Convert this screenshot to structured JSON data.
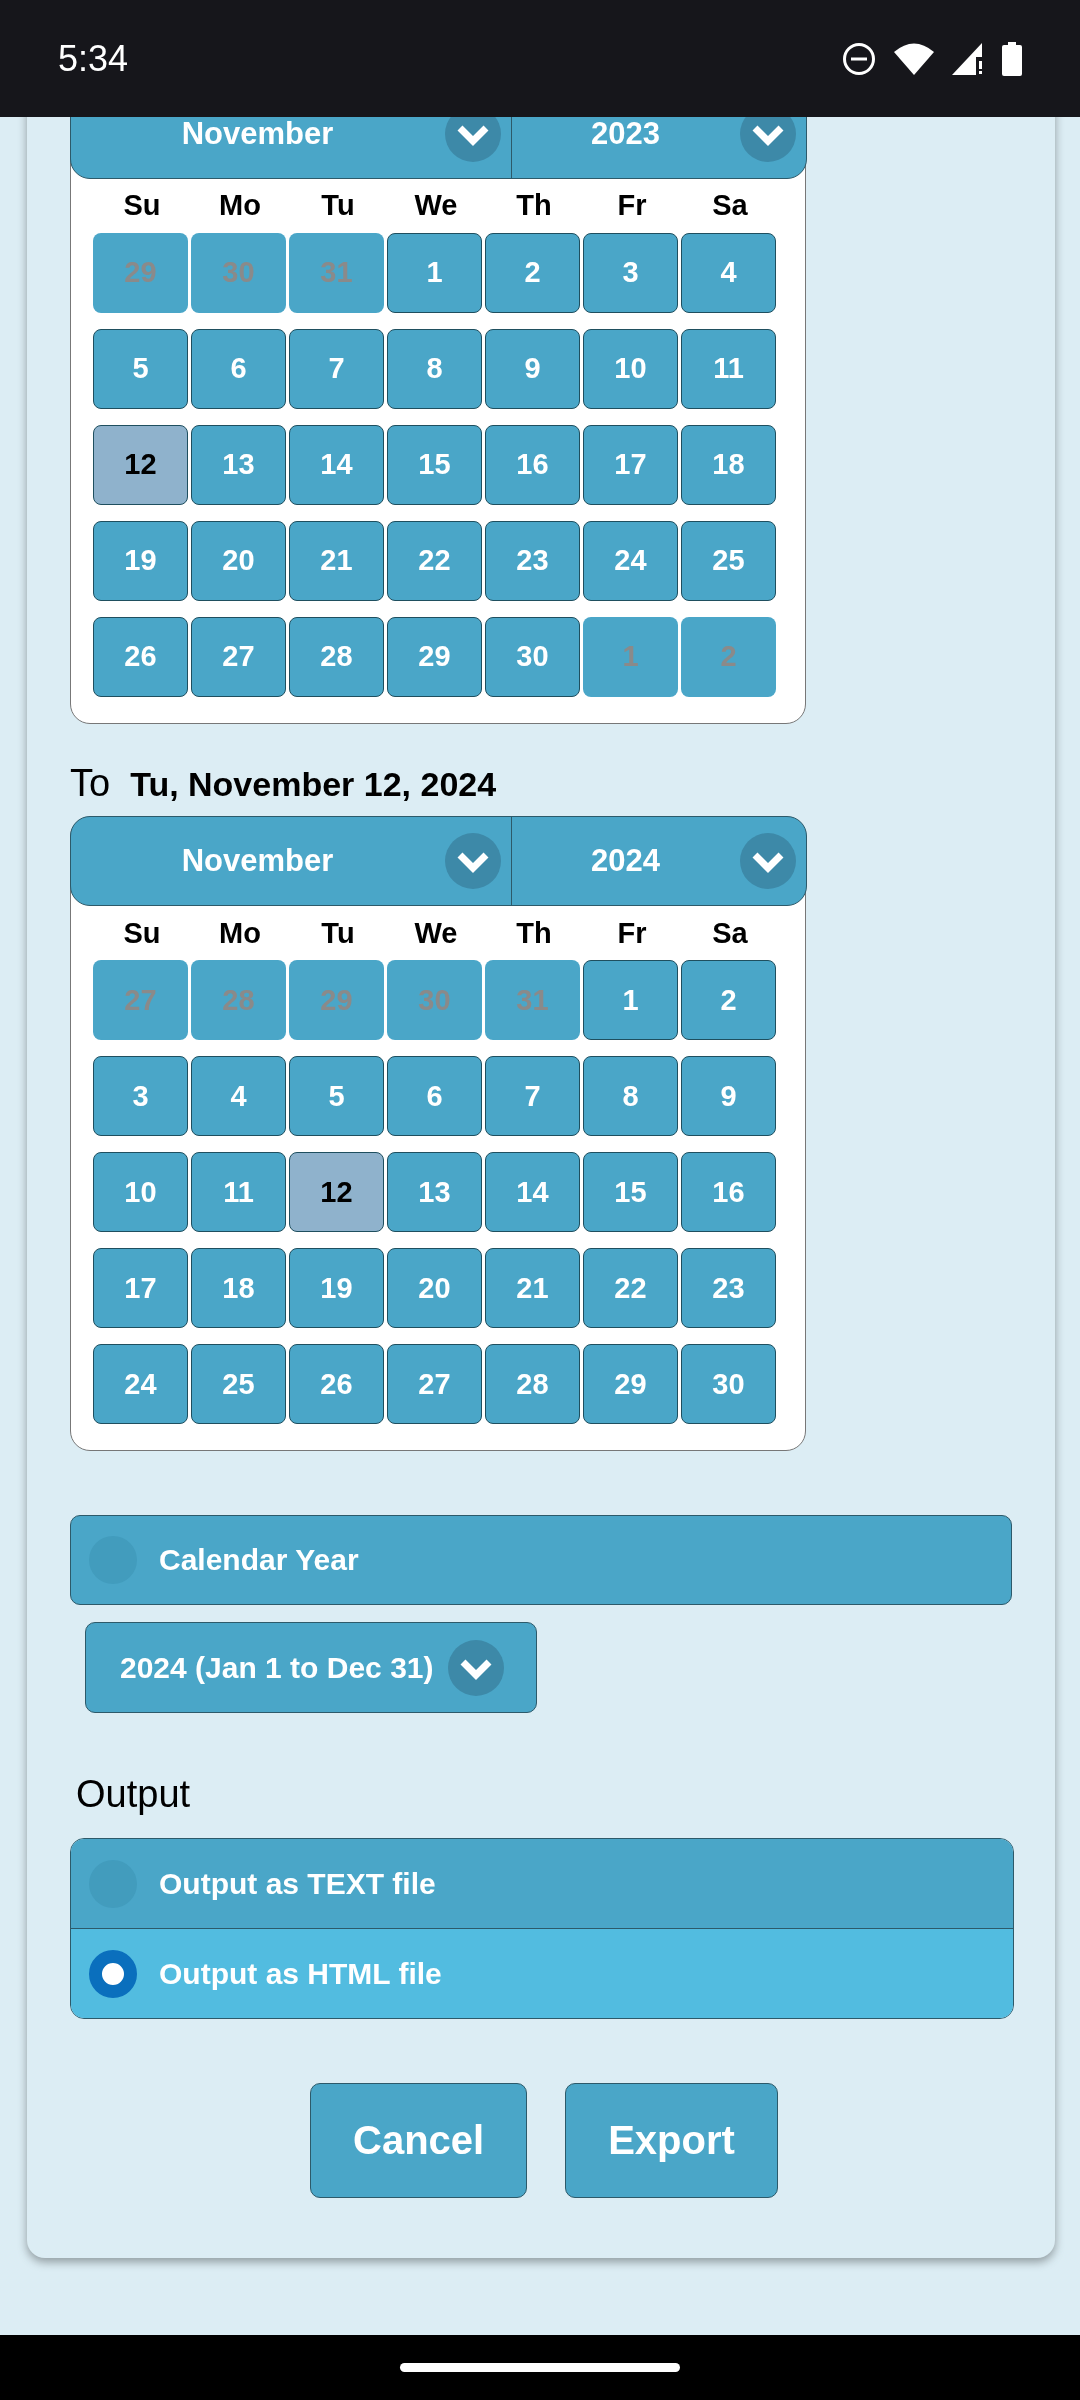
{
  "status_bar": {
    "time": "5:34"
  },
  "calendars": [
    {
      "month": "November",
      "year": "2023",
      "weekdays": [
        "Su",
        "Mo",
        "Tu",
        "We",
        "Th",
        "Fr",
        "Sa"
      ],
      "days": [
        {
          "label": "29",
          "in_month": false,
          "selected": false
        },
        {
          "label": "30",
          "in_month": false,
          "selected": false
        },
        {
          "label": "31",
          "in_month": false,
          "selected": false
        },
        {
          "label": "1",
          "in_month": true,
          "selected": false
        },
        {
          "label": "2",
          "in_month": true,
          "selected": false
        },
        {
          "label": "3",
          "in_month": true,
          "selected": false
        },
        {
          "label": "4",
          "in_month": true,
          "selected": false
        },
        {
          "label": "5",
          "in_month": true,
          "selected": false
        },
        {
          "label": "6",
          "in_month": true,
          "selected": false
        },
        {
          "label": "7",
          "in_month": true,
          "selected": false
        },
        {
          "label": "8",
          "in_month": true,
          "selected": false
        },
        {
          "label": "9",
          "in_month": true,
          "selected": false
        },
        {
          "label": "10",
          "in_month": true,
          "selected": false
        },
        {
          "label": "11",
          "in_month": true,
          "selected": false
        },
        {
          "label": "12",
          "in_month": true,
          "selected": true
        },
        {
          "label": "13",
          "in_month": true,
          "selected": false
        },
        {
          "label": "14",
          "in_month": true,
          "selected": false
        },
        {
          "label": "15",
          "in_month": true,
          "selected": false
        },
        {
          "label": "16",
          "in_month": true,
          "selected": false
        },
        {
          "label": "17",
          "in_month": true,
          "selected": false
        },
        {
          "label": "18",
          "in_month": true,
          "selected": false
        },
        {
          "label": "19",
          "in_month": true,
          "selected": false
        },
        {
          "label": "20",
          "in_month": true,
          "selected": false
        },
        {
          "label": "21",
          "in_month": true,
          "selected": false
        },
        {
          "label": "22",
          "in_month": true,
          "selected": false
        },
        {
          "label": "23",
          "in_month": true,
          "selected": false
        },
        {
          "label": "24",
          "in_month": true,
          "selected": false
        },
        {
          "label": "25",
          "in_month": true,
          "selected": false
        },
        {
          "label": "26",
          "in_month": true,
          "selected": false
        },
        {
          "label": "27",
          "in_month": true,
          "selected": false
        },
        {
          "label": "28",
          "in_month": true,
          "selected": false
        },
        {
          "label": "29",
          "in_month": true,
          "selected": false
        },
        {
          "label": "30",
          "in_month": true,
          "selected": false
        },
        {
          "label": "1",
          "in_month": false,
          "selected": false
        },
        {
          "label": "2",
          "in_month": false,
          "selected": false
        }
      ]
    },
    {
      "prefix": "To",
      "date_label": "Tu, November 12, 2024",
      "month": "November",
      "year": "2024",
      "weekdays": [
        "Su",
        "Mo",
        "Tu",
        "We",
        "Th",
        "Fr",
        "Sa"
      ],
      "days": [
        {
          "label": "27",
          "in_month": false,
          "selected": false
        },
        {
          "label": "28",
          "in_month": false,
          "selected": false
        },
        {
          "label": "29",
          "in_month": false,
          "selected": false
        },
        {
          "label": "30",
          "in_month": false,
          "selected": false
        },
        {
          "label": "31",
          "in_month": false,
          "selected": false
        },
        {
          "label": "1",
          "in_month": true,
          "selected": false
        },
        {
          "label": "2",
          "in_month": true,
          "selected": false
        },
        {
          "label": "3",
          "in_month": true,
          "selected": false
        },
        {
          "label": "4",
          "in_month": true,
          "selected": false
        },
        {
          "label": "5",
          "in_month": true,
          "selected": false
        },
        {
          "label": "6",
          "in_month": true,
          "selected": false
        },
        {
          "label": "7",
          "in_month": true,
          "selected": false
        },
        {
          "label": "8",
          "in_month": true,
          "selected": false
        },
        {
          "label": "9",
          "in_month": true,
          "selected": false
        },
        {
          "label": "10",
          "in_month": true,
          "selected": false
        },
        {
          "label": "11",
          "in_month": true,
          "selected": false
        },
        {
          "label": "12",
          "in_month": true,
          "selected": true
        },
        {
          "label": "13",
          "in_month": true,
          "selected": false
        },
        {
          "label": "14",
          "in_month": true,
          "selected": false
        },
        {
          "label": "15",
          "in_month": true,
          "selected": false
        },
        {
          "label": "16",
          "in_month": true,
          "selected": false
        },
        {
          "label": "17",
          "in_month": true,
          "selected": false
        },
        {
          "label": "18",
          "in_month": true,
          "selected": false
        },
        {
          "label": "19",
          "in_month": true,
          "selected": false
        },
        {
          "label": "20",
          "in_month": true,
          "selected": false
        },
        {
          "label": "21",
          "in_month": true,
          "selected": false
        },
        {
          "label": "22",
          "in_month": true,
          "selected": false
        },
        {
          "label": "23",
          "in_month": true,
          "selected": false
        },
        {
          "label": "24",
          "in_month": true,
          "selected": false
        },
        {
          "label": "25",
          "in_month": true,
          "selected": false
        },
        {
          "label": "26",
          "in_month": true,
          "selected": false
        },
        {
          "label": "27",
          "in_month": true,
          "selected": false
        },
        {
          "label": "28",
          "in_month": true,
          "selected": false
        },
        {
          "label": "29",
          "in_month": true,
          "selected": false
        },
        {
          "label": "30",
          "in_month": true,
          "selected": false
        }
      ]
    }
  ],
  "calendar_year": {
    "label": "Calendar Year",
    "selected": false,
    "dropdown": "2024 (Jan 1 to Dec 31)"
  },
  "output": {
    "heading": "Output",
    "options": [
      {
        "label": "Output as TEXT file",
        "selected": false
      },
      {
        "label": "Output as HTML file",
        "selected": true
      }
    ]
  },
  "buttons": [
    "Cancel",
    "Export"
  ]
}
